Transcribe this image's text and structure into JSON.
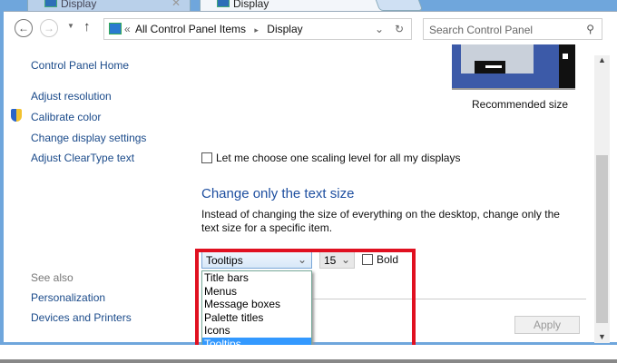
{
  "tabs": [
    {
      "label": "Display"
    },
    {
      "label": "Display"
    }
  ],
  "address": {
    "root": "«",
    "crumb1": "All Control Panel Items",
    "sep": "▸",
    "crumb2": "Display"
  },
  "search": {
    "placeholder": "Search Control Panel"
  },
  "sidebar": {
    "home": "Control Panel Home",
    "items": [
      "Adjust resolution",
      "Calibrate color",
      "Change display settings",
      "Adjust ClearType text"
    ],
    "see_also": "See also",
    "see_also_items": [
      "Personalization",
      "Devices and Printers"
    ]
  },
  "preview": {
    "caption": "Recommended size"
  },
  "scaling_checkbox": "Let me choose one scaling level for all my displays",
  "text_size": {
    "heading": "Change only the text size",
    "description": "Instead of changing the size of everything on the desktop, change only the text size for a specific item.",
    "item_selected": "Tooltips",
    "size_selected": "15",
    "bold_label": "Bold",
    "options": [
      "Title bars",
      "Menus",
      "Message boxes",
      "Palette titles",
      "Icons",
      "Tooltips"
    ]
  },
  "apply_label": "Apply"
}
